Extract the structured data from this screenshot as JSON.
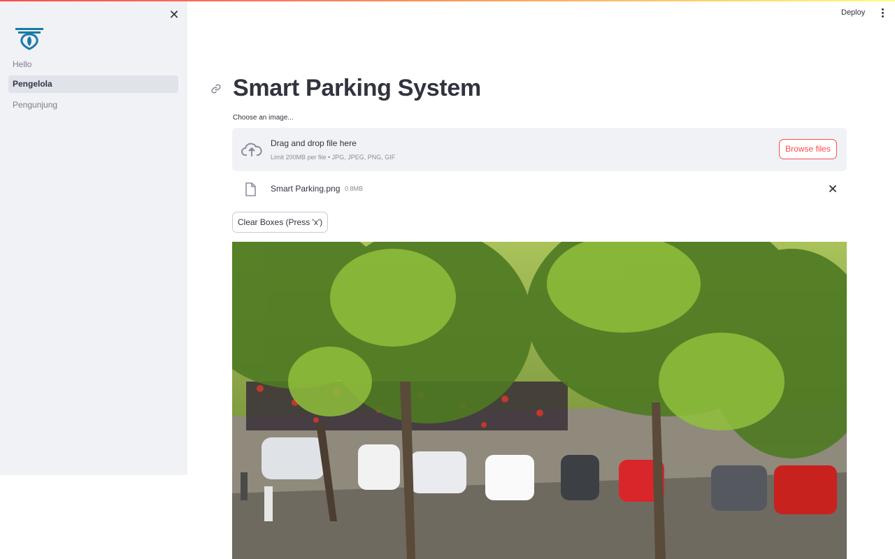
{
  "sidebar": {
    "close_icon": "close-icon",
    "logo_icon": "app-logo",
    "items": [
      {
        "label": "Hello",
        "active": false
      },
      {
        "label": "Pengelola",
        "active": true
      },
      {
        "label": "Pengunjung",
        "active": false
      }
    ]
  },
  "header": {
    "deploy_label": "Deploy",
    "menu_icon": "kebab-menu-icon"
  },
  "main": {
    "title": "Smart Parking System",
    "uploader": {
      "label": "Choose an image...",
      "dropzone_title": "Drag and drop file here",
      "dropzone_subtitle": "Limit 200MB per file • JPG, JPEG, PNG, GIF",
      "browse_label": "Browse files",
      "file": {
        "name": "Smart Parking.png",
        "size": "0.8MB"
      }
    },
    "clear_button_label": "Clear Boxes (Press 'x')"
  },
  "colors": {
    "accent": "#ff4b4b",
    "sidebar_bg": "#f0f2f6",
    "text": "#31333f",
    "logo": "#1a7aa8"
  }
}
